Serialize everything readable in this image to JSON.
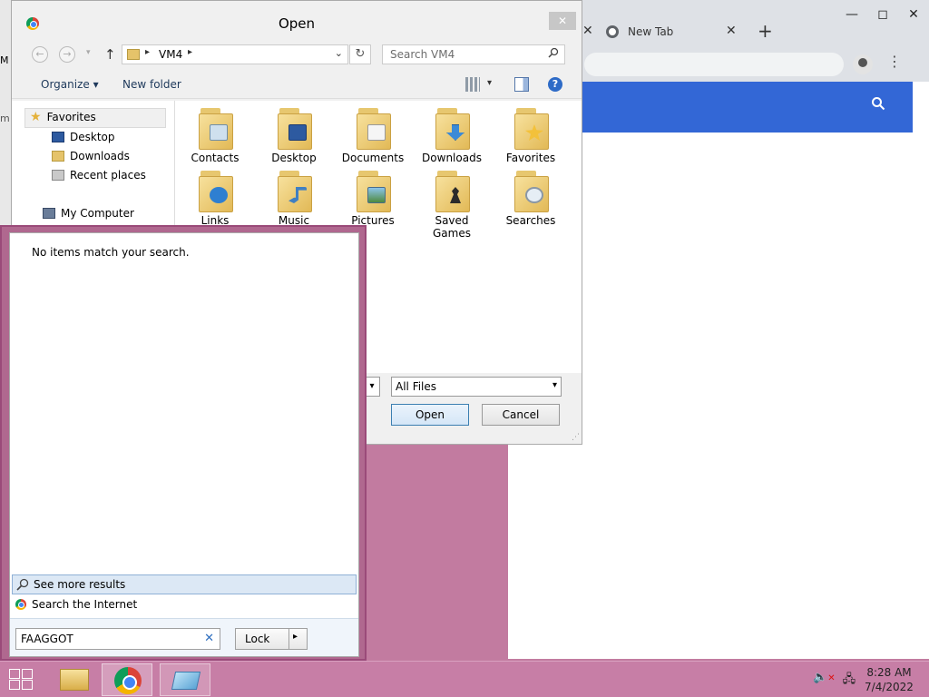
{
  "desktop_strip": {
    "mark1": "M",
    "mark2": "m"
  },
  "chrome": {
    "new_tab_label": "New Tab",
    "tab_close": "✕",
    "add_tab": "+",
    "win_min": "—",
    "win_max": "◻",
    "win_close": "✕",
    "menu_dots": "⋮",
    "search_icon": "search-icon",
    "bar_color": "#3367d6"
  },
  "dialog": {
    "title": "Open",
    "close": "✕",
    "breadcrumb": "VM4",
    "search_placeholder": "Search VM4",
    "organize": "Organize ▾",
    "new_folder": "New folder",
    "nav_pane": {
      "favorites": "Favorites",
      "items": [
        "Desktop",
        "Downloads",
        "Recent places"
      ],
      "my_computer": "My Computer"
    },
    "files": [
      {
        "name": "Contacts"
      },
      {
        "name": "Desktop"
      },
      {
        "name": "Documents"
      },
      {
        "name": "Downloads"
      },
      {
        "name": "Favorites"
      },
      {
        "name": "Links"
      },
      {
        "name": "Music"
      },
      {
        "name": "Pictures"
      },
      {
        "name": "Saved Games"
      },
      {
        "name": "Searches"
      }
    ],
    "file_type": "All Files",
    "open_button": "Open",
    "cancel_button": "Cancel"
  },
  "start_panel": {
    "no_items": "No items match your search.",
    "see_more": "See more results",
    "search_internet": "Search the Internet",
    "query": "FAAGGOT",
    "clear": "✕",
    "lock": "Lock",
    "lock_arrow": "▸"
  },
  "taskbar": {
    "time": "8:28 AM",
    "date": "7/4/2022"
  }
}
